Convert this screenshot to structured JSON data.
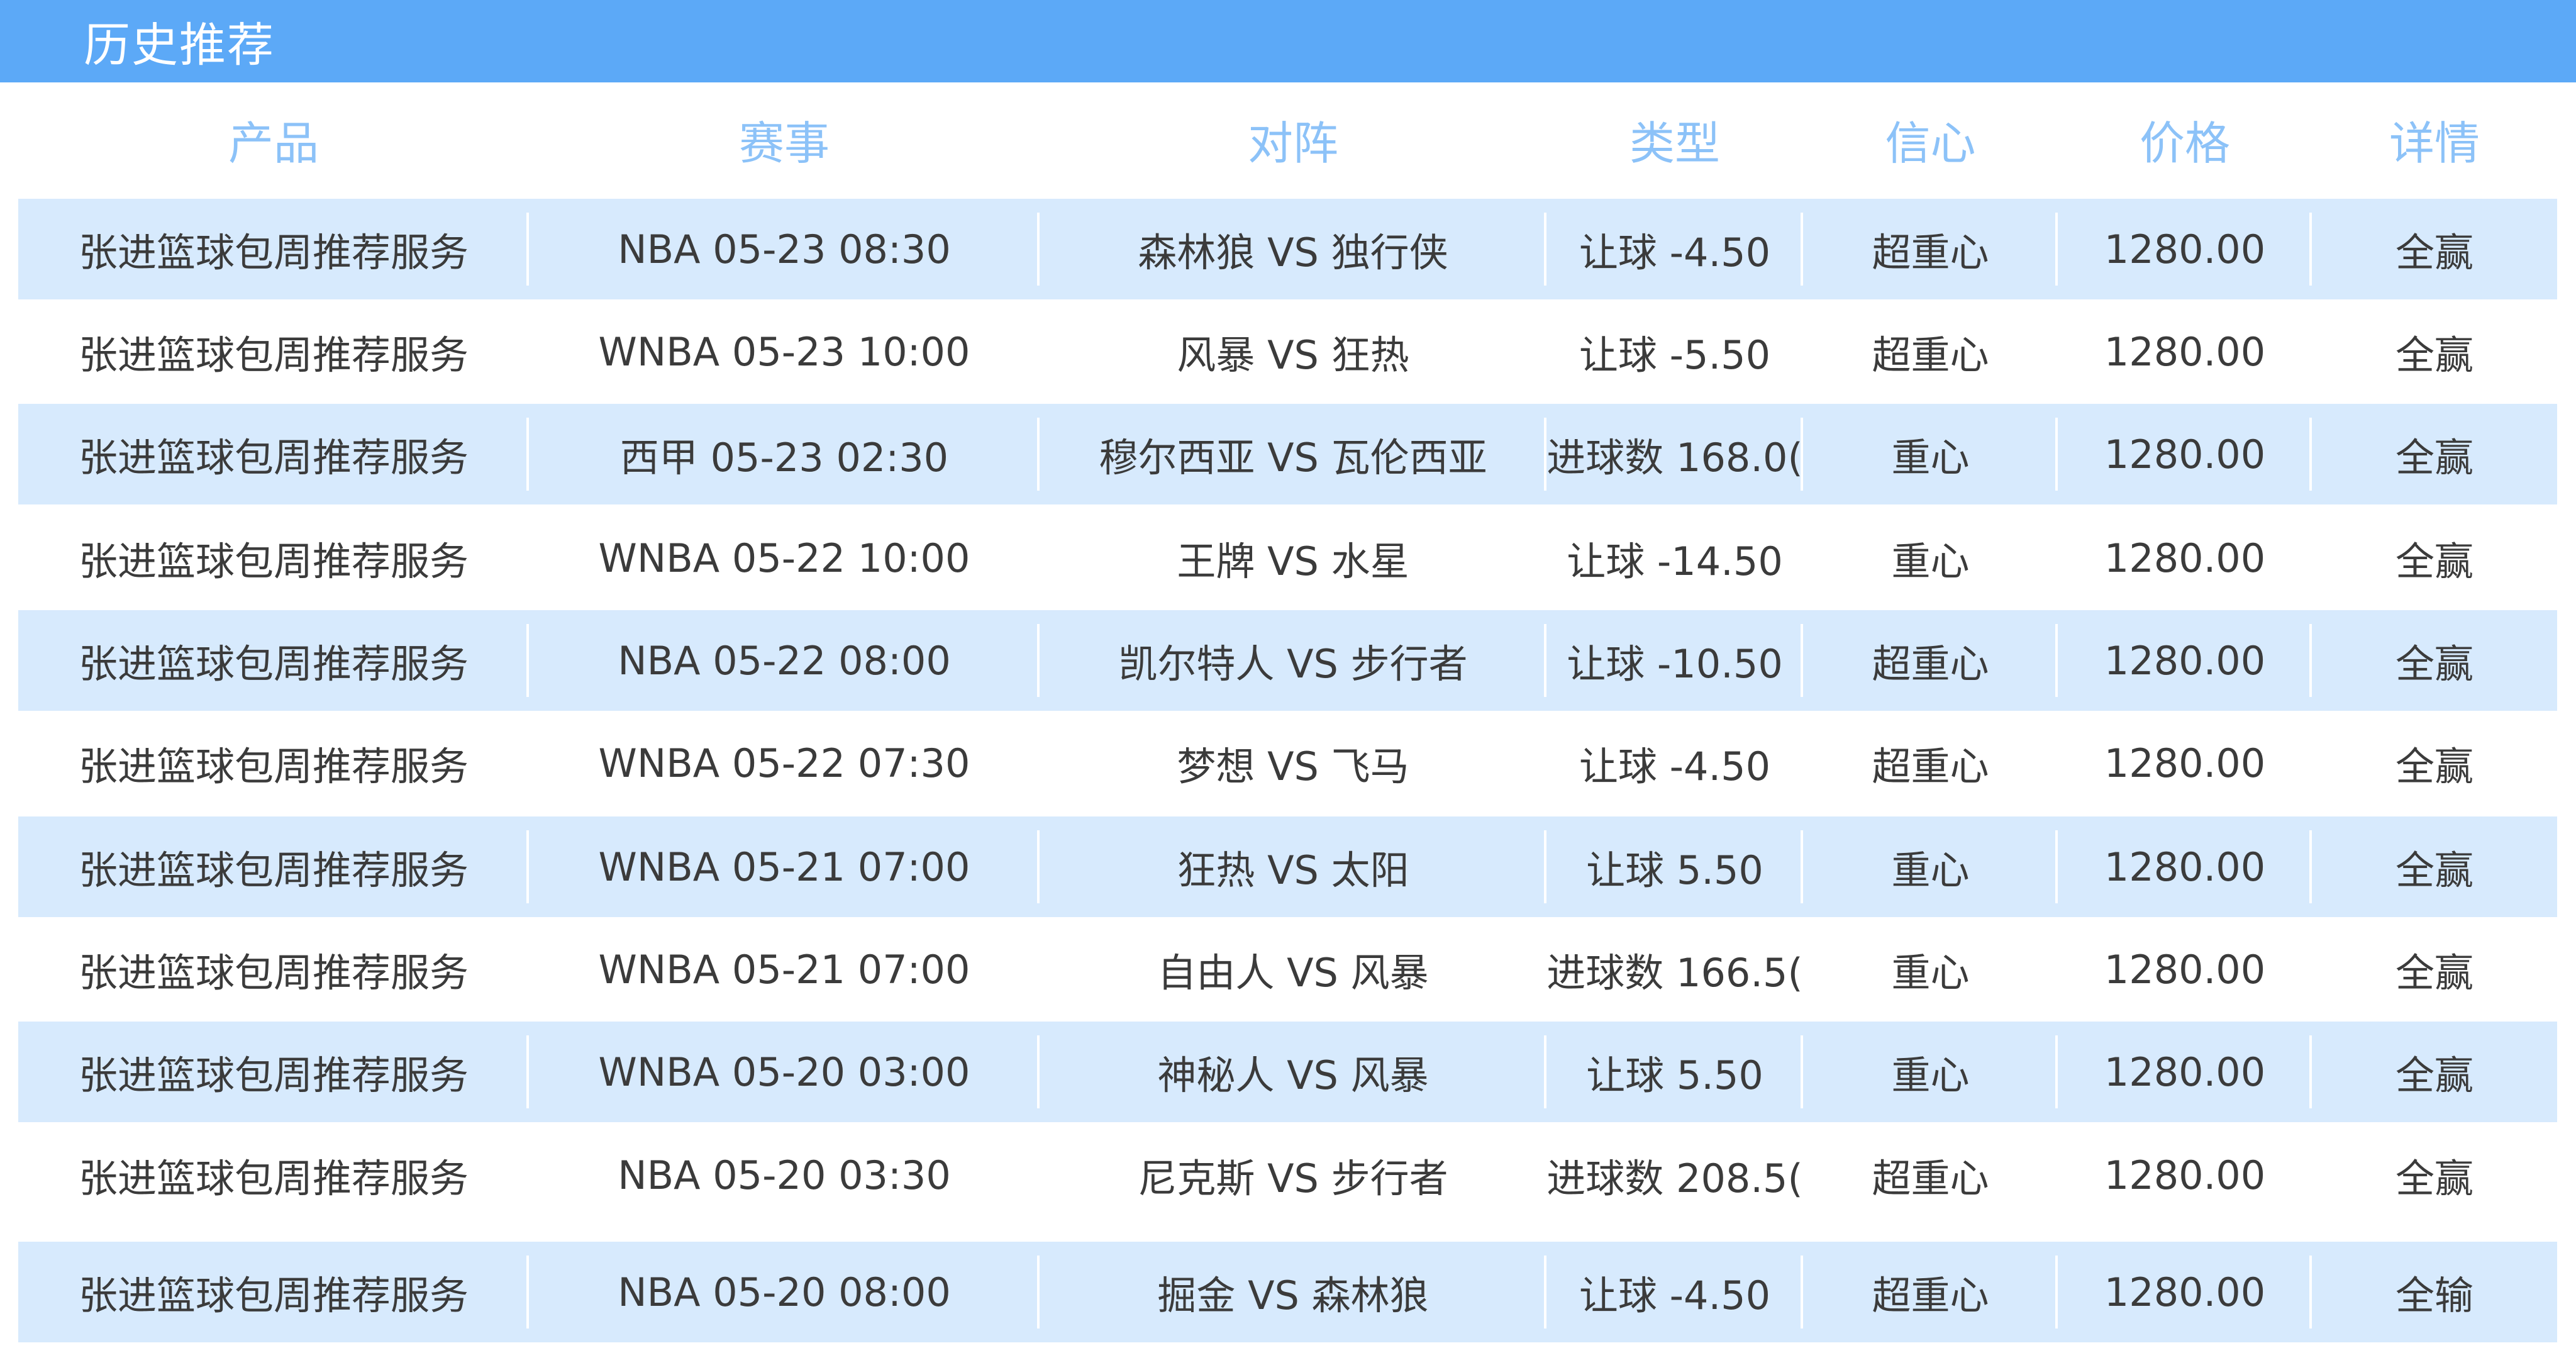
{
  "panel": {
    "title": "历史推荐"
  },
  "columns": [
    "产品",
    "赛事",
    "对阵",
    "类型",
    "信心",
    "价格",
    "详情"
  ],
  "rows": [
    {
      "product": "张进篮球包周推荐服务",
      "event": "NBA 05-23 08:30",
      "match": "森林狼 VS 独行侠",
      "type": "让球 -4.50",
      "confidence": "超重心",
      "price": "1280.00",
      "detail": "全赢"
    },
    {
      "product": "张进篮球包周推荐服务",
      "event": "WNBA 05-23 10:00",
      "match": "风暴 VS 狂热",
      "type": "让球 -5.50",
      "confidence": "超重心",
      "price": "1280.00",
      "detail": "全赢"
    },
    {
      "product": "张进篮球包周推荐服务",
      "event": "西甲 05-23 02:30",
      "match": "穆尔西亚 VS 瓦伦西亚",
      "type": "进球数 168.0(",
      "confidence": "重心",
      "price": "1280.00",
      "detail": "全赢"
    },
    {
      "product": "张进篮球包周推荐服务",
      "event": "WNBA 05-22 10:00",
      "match": "王牌 VS 水星",
      "type": "让球 -14.50",
      "confidence": "重心",
      "price": "1280.00",
      "detail": "全赢"
    },
    {
      "product": "张进篮球包周推荐服务",
      "event": "NBA 05-22 08:00",
      "match": "凯尔特人 VS 步行者",
      "type": "让球 -10.50",
      "confidence": "超重心",
      "price": "1280.00",
      "detail": "全赢"
    },
    {
      "product": "张进篮球包周推荐服务",
      "event": "WNBA 05-22 07:30",
      "match": "梦想 VS 飞马",
      "type": "让球 -4.50",
      "confidence": "超重心",
      "price": "1280.00",
      "detail": "全赢"
    },
    {
      "product": "张进篮球包周推荐服务",
      "event": "WNBA 05-21 07:00",
      "match": "狂热 VS 太阳",
      "type": "让球 5.50",
      "confidence": "重心",
      "price": "1280.00",
      "detail": "全赢"
    },
    {
      "product": "张进篮球包周推荐服务",
      "event": "WNBA 05-21 07:00",
      "match": "自由人 VS 风暴",
      "type": "进球数 166.5(",
      "confidence": "重心",
      "price": "1280.00",
      "detail": "全赢"
    },
    {
      "product": "张进篮球包周推荐服务",
      "event": "WNBA 05-20 03:00",
      "match": "神秘人 VS 风暴",
      "type": "让球 5.50",
      "confidence": "重心",
      "price": "1280.00",
      "detail": "全赢"
    },
    {
      "product": "张进篮球包周推荐服务",
      "event": "NBA 05-20 03:30",
      "match": "尼克斯 VS 步行者",
      "type": "进球数 208.5(",
      "confidence": "超重心",
      "price": "1280.00",
      "detail": "全赢"
    },
    {
      "product": "张进篮球包周推荐服务",
      "event": "NBA 05-20 08:00",
      "match": "掘金 VS 森林狼",
      "type": "让球 -4.50",
      "confidence": "超重心",
      "price": "1280.00",
      "detail": "全输"
    }
  ],
  "colors": {
    "title_bar": "#5ca9f7",
    "header_text": "#8cc2f8",
    "row_shade": "#d7eafd",
    "cell_text": "#3b3b3b"
  }
}
